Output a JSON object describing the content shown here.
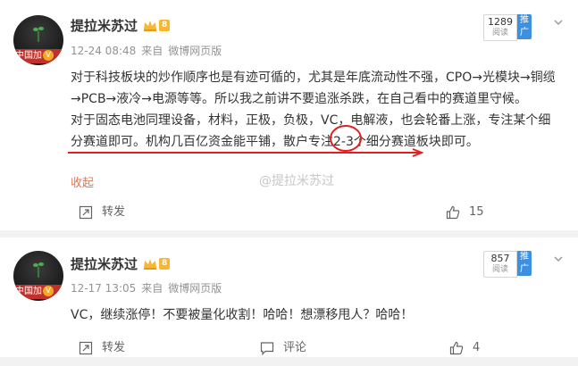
{
  "posts": [
    {
      "avatar_ribbon_text": "中国加",
      "avatar_v": "V",
      "username": "提拉米苏过",
      "level": "8",
      "date": "12-24 08:48",
      "source_prefix": "来自",
      "source": "微博网页版",
      "read_count": "1289",
      "read_label": "阅读",
      "promo_label": "推广",
      "paragraph1": "对于科技板块的炒作顺序也是有迹可循的，尤其是年底流动性不强，CPO→光模块→铜缆→PCB→液冷→电源等等。所以我之前讲不要追涨杀跌，在自己看中的赛道里守候。",
      "paragraph2": "对于固态电池同理设备，材料，正极，负极，VC，电解液，也会轮番上涨，专注某个细分赛道即可。机构几百亿资金能平铺，散户专注2-3个细分赛道板块即可。",
      "fold_label": "收起",
      "watermark": "@提拉米苏过",
      "repost_label": "转发",
      "like_count": "15"
    },
    {
      "avatar_ribbon_text": "中国加",
      "avatar_v": "V",
      "username": "提拉米苏过",
      "level": "8",
      "date": "12-17 13:05",
      "source_prefix": "来自",
      "source": "微博网页版",
      "read_count": "857",
      "read_label": "阅读",
      "promo_label": "推广",
      "text": "VC，继续涨停！不要被量化收割！哈哈！想漂移甩人？哈哈！",
      "repost_label": "转发",
      "comment_label": "评论",
      "like_count": "4"
    }
  ],
  "colors": {
    "annotation_red": "#e02020",
    "promo_blue": "#3d8fe0",
    "fold_orange": "#eb7350"
  }
}
